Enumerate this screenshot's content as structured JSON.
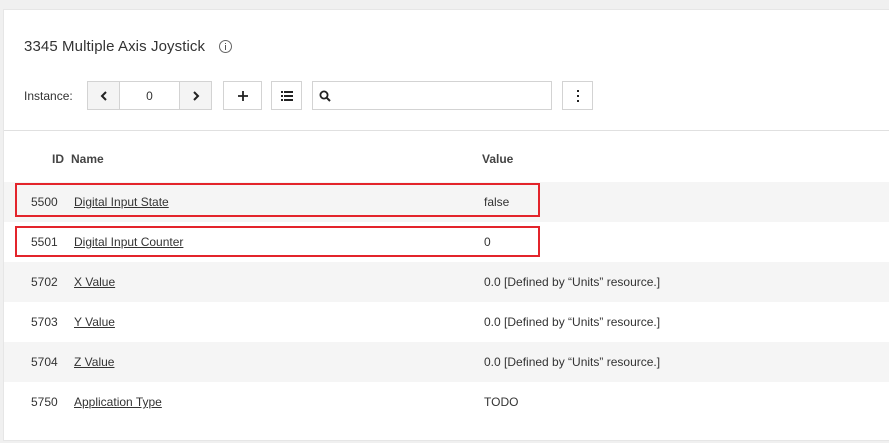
{
  "object": {
    "title": "3345 Multiple Axis Joystick",
    "info_icon": "info-circle-icon"
  },
  "toolbar": {
    "instance_label": "Instance:",
    "instance_value": "0",
    "prev_icon": "chevron-left-icon",
    "next_icon": "chevron-right-icon",
    "add_icon": "plus-icon",
    "list_icon": "list-icon",
    "search_icon": "search-icon",
    "search_value": "",
    "more_icon": "more-vertical-icon"
  },
  "table": {
    "columns": {
      "id": "ID",
      "name": "Name",
      "value": "Value"
    },
    "rows": [
      {
        "id": "5500",
        "name": "Digital Input State",
        "value": "false",
        "highlighted": true
      },
      {
        "id": "5501",
        "name": "Digital Input Counter",
        "value": "0",
        "highlighted": true
      },
      {
        "id": "5702",
        "name": "X Value",
        "value": "0.0 [Defined by “Units” resource.]",
        "highlighted": false
      },
      {
        "id": "5703",
        "name": "Y Value",
        "value": "0.0 [Defined by “Units” resource.]",
        "highlighted": false
      },
      {
        "id": "5704",
        "name": "Z Value",
        "value": "0.0 [Defined by “Units” resource.]",
        "highlighted": false
      },
      {
        "id": "5750",
        "name": "Application Type",
        "value": "TODO",
        "highlighted": false
      }
    ]
  },
  "colors": {
    "highlight": "#e3242b",
    "row_alt": "#f5f5f5"
  }
}
